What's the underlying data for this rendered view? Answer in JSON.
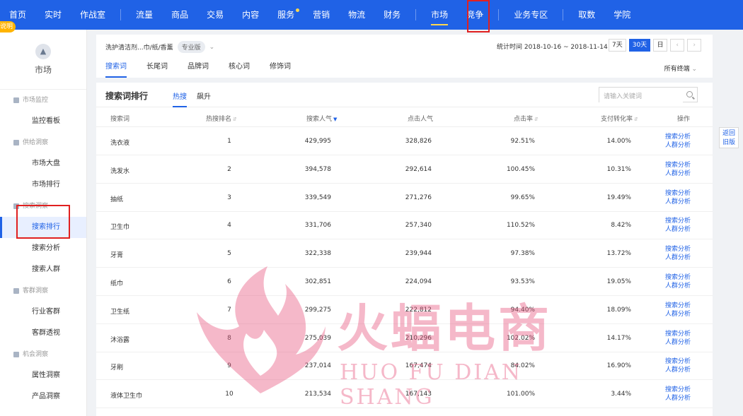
{
  "topnav": {
    "items": [
      {
        "label": "首页"
      },
      {
        "label": "实时"
      },
      {
        "label": "作战室"
      },
      {
        "label": "流量"
      },
      {
        "label": "商品"
      },
      {
        "label": "交易"
      },
      {
        "label": "内容"
      },
      {
        "label": "服务"
      },
      {
        "label": "营销"
      },
      {
        "label": "物流"
      },
      {
        "label": "财务"
      },
      {
        "label": "市场"
      },
      {
        "label": "竞争"
      },
      {
        "label": "业务专区"
      },
      {
        "label": "取数"
      },
      {
        "label": "学院"
      }
    ],
    "active": "市场",
    "accent": "#2062e6"
  },
  "sidebar": {
    "module_label": "市场",
    "explain_badge": "说明",
    "groups": [
      {
        "label": "市场监控",
        "items": [
          "监控看板"
        ]
      },
      {
        "label": "供给洞察",
        "items": [
          "市场大盘",
          "市场排行"
        ]
      },
      {
        "label": "搜索洞察",
        "items": [
          "搜索排行",
          "搜索分析",
          "搜索人群"
        ]
      },
      {
        "label": "客群洞察",
        "items": [
          "行业客群",
          "客群透视"
        ]
      },
      {
        "label": "机会洞察",
        "items": [
          "属性洞察",
          "产品洞察"
        ]
      }
    ],
    "active_item": "搜索排行"
  },
  "filter": {
    "category": "洗护清洁剂...巾/纸/香薰",
    "edition_badge": "专业版",
    "stat_time": "统计时间 2018-10-16 ~ 2018-11-14",
    "range_buttons": [
      "7天",
      "30天",
      "日"
    ],
    "active_range": "30天",
    "prev": "‹",
    "next": "›",
    "subtabs": [
      "搜索词",
      "长尾词",
      "品牌词",
      "核心词",
      "修饰词"
    ],
    "active_subtab": "搜索词",
    "terminal": "所有终端"
  },
  "ranking": {
    "title": "搜索词排行",
    "tabs": [
      "热搜",
      "飙升"
    ],
    "active_tab": "热搜",
    "search_placeholder": "请输入关键词",
    "columns": [
      "搜索词",
      "热搜排名",
      "搜索人气",
      "点击人气",
      "点击率",
      "支付转化率",
      "操作"
    ],
    "op_labels": [
      "搜索分析",
      "人群分析"
    ],
    "rows": [
      {
        "kw": "洗衣液",
        "rank": "1",
        "pop": "429,995",
        "click": "328,826",
        "ctr": "92.51%",
        "cvr": "14.00%"
      },
      {
        "kw": "洗发水",
        "rank": "2",
        "pop": "394,578",
        "click": "292,614",
        "ctr": "100.45%",
        "cvr": "10.31%"
      },
      {
        "kw": "抽纸",
        "rank": "3",
        "pop": "339,549",
        "click": "271,276",
        "ctr": "99.65%",
        "cvr": "19.49%"
      },
      {
        "kw": "卫生巾",
        "rank": "4",
        "pop": "331,706",
        "click": "257,340",
        "ctr": "110.52%",
        "cvr": "8.42%"
      },
      {
        "kw": "牙膏",
        "rank": "5",
        "pop": "322,338",
        "click": "239,944",
        "ctr": "97.38%",
        "cvr": "13.72%"
      },
      {
        "kw": "纸巾",
        "rank": "6",
        "pop": "302,851",
        "click": "224,094",
        "ctr": "93.53%",
        "cvr": "19.05%"
      },
      {
        "kw": "卫生纸",
        "rank": "7",
        "pop": "299,275",
        "click": "222,812",
        "ctr": "94.40%",
        "cvr": "18.09%"
      },
      {
        "kw": "沐浴露",
        "rank": "8",
        "pop": "275,039",
        "click": "210,296",
        "ctr": "102.02%",
        "cvr": "14.17%"
      },
      {
        "kw": "牙刷",
        "rank": "9",
        "pop": "237,014",
        "click": "167,474",
        "ctr": "84.02%",
        "cvr": "16.90%"
      },
      {
        "kw": "液体卫生巾",
        "rank": "10",
        "pop": "213,534",
        "click": "167,143",
        "ctr": "101.00%",
        "cvr": "3.44%"
      }
    ]
  },
  "float_back": {
    "line1": "返回",
    "line2": "旧版"
  },
  "watermark": {
    "text": "火蝠电商",
    "sub": "HUO FU DIAN SHANG"
  }
}
